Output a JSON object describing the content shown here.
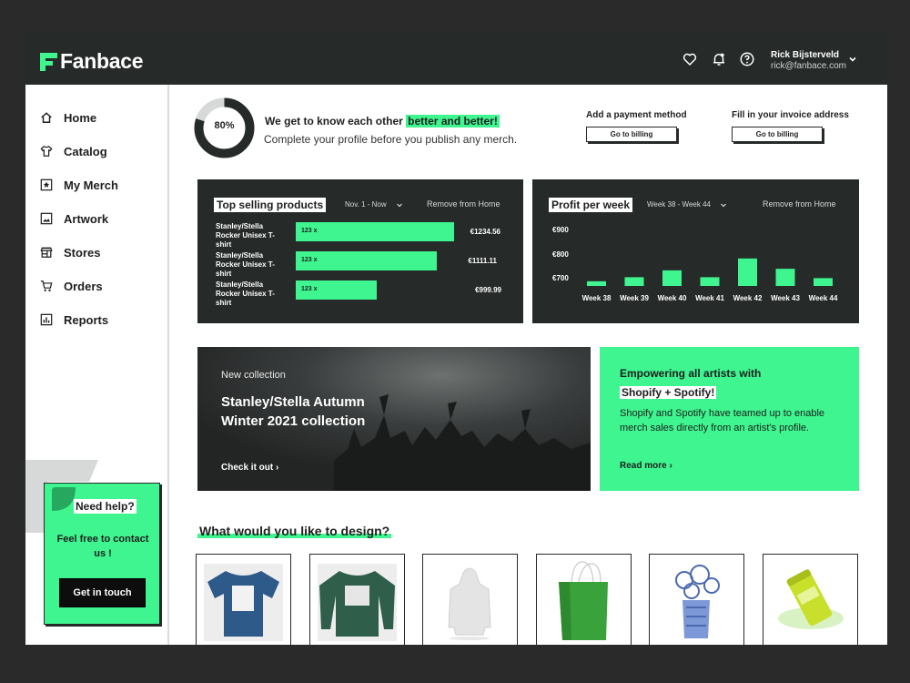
{
  "brand": {
    "name": "Fanbace",
    "accent": "#3ef58f",
    "dark": "#262a29"
  },
  "header": {
    "icons": [
      "heart-icon",
      "bell-icon",
      "help-icon"
    ],
    "user": {
      "name": "Rick Bijsterveld",
      "email": "rick@fanbace.com"
    }
  },
  "sidebar": {
    "items": [
      {
        "label": "Home",
        "icon": "home-icon"
      },
      {
        "label": "Catalog",
        "icon": "shirt-icon"
      },
      {
        "label": "My Merch",
        "icon": "star-icon"
      },
      {
        "label": "Artwork",
        "icon": "image-icon"
      },
      {
        "label": "Stores",
        "icon": "store-icon"
      },
      {
        "label": "Orders",
        "icon": "cart-icon"
      },
      {
        "label": "Reports",
        "icon": "chart-icon"
      }
    ],
    "help": {
      "title": "Need help?",
      "text": "Feel free to contact us !",
      "button": "Get in touch"
    }
  },
  "profile": {
    "percent_label": "80%",
    "completion": 0.8,
    "title_pre": "We get to know each other ",
    "title_highlight": "better and better!",
    "subtitle": "Complete your profile before you publish any merch."
  },
  "actions": [
    {
      "label": "Add a payment method",
      "button": "Go to billing"
    },
    {
      "label": "Fill in your invoice address",
      "button": "Go to billing"
    }
  ],
  "top_selling": {
    "title": "Top selling products",
    "range": "Nov. 1 - Now",
    "remove": "Remove from Home",
    "products": [
      {
        "name": "Stanley/Stella Rocker Unisex T-shirt",
        "qty": "123 x",
        "price": "€1234.56",
        "share": 1.0
      },
      {
        "name": "Stanley/Stella Rocker Unisex T-shirt",
        "qty": "123 x",
        "price": "€1111.11",
        "share": 0.89
      },
      {
        "name": "Stanley/Stella Rocker Unisex T-shirt",
        "qty": "123 x",
        "price": "€999.99",
        "share": 0.51
      }
    ]
  },
  "profit": {
    "title": "Profit per week",
    "range": "Week 38 - Week 44",
    "remove": "Remove from Home"
  },
  "chart_data": {
    "type": "bar",
    "title": "Profit per week",
    "categories": [
      "Week 38",
      "Week 39",
      "Week 40",
      "Week 41",
      "Week 42",
      "Week 43",
      "Week 44"
    ],
    "values": [
      705,
      718,
      740,
      718,
      778,
      745,
      715
    ],
    "ytick_labels": [
      "€900",
      "€800",
      "€700"
    ],
    "ylim": [
      690,
      900
    ],
    "grid": false
  },
  "collection": {
    "kicker": "New collection",
    "title": "Stanley/Stella Autumn Winter 2021 collection",
    "link": "Check it out"
  },
  "promo": {
    "title_line1": "Empowering all artists with",
    "title_line2": "Shopify + Spotify!",
    "body": "Shopify and Spotify have teamed up to enable merch sales directly from an artist's profile.",
    "link": "Read more"
  },
  "design": {
    "title": "What would you like to design?",
    "products": [
      "t-shirt",
      "sweater",
      "hoodie",
      "shopping-bag",
      "vase",
      "can"
    ]
  }
}
